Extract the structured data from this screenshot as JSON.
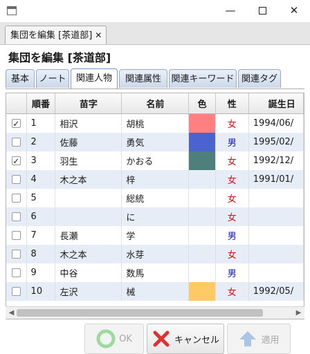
{
  "window": {
    "minimize_glyph": "—",
    "close_glyph": "✕"
  },
  "outer_tab": {
    "label": "集団を編集 [茶道部]",
    "close_glyph": "✕"
  },
  "panel_title": "集団を編集 [茶道部]",
  "inner_tabs": [
    "基本",
    "ノート",
    "関連人物",
    "関連属性",
    "関連キーワード",
    "関連タグ"
  ],
  "active_inner_tab": "関連人物",
  "table": {
    "columns": [
      "",
      "順番",
      "苗字",
      "名前",
      "色",
      "性",
      "誕生日"
    ],
    "rows": [
      {
        "checked": true,
        "order": "1",
        "surname": "相沢",
        "name": "胡桃",
        "color": "#ff8080",
        "sex": "女",
        "birthday": "1994/06/"
      },
      {
        "checked": false,
        "order": "2",
        "surname": "佐藤",
        "name": "勇気",
        "color": "#4b63cf",
        "sex": "男",
        "birthday": "1995/02/"
      },
      {
        "checked": true,
        "order": "3",
        "surname": "羽生",
        "name": "かおる",
        "color": "#4f7f7b",
        "sex": "女",
        "birthday": "1992/12/"
      },
      {
        "checked": false,
        "order": "4",
        "surname": "木之本",
        "name": "梓",
        "color": "",
        "sex": "女",
        "birthday": "1991/01/"
      },
      {
        "checked": false,
        "order": "5",
        "surname": "",
        "name": "総統",
        "color": "",
        "sex": "女",
        "birthday": ""
      },
      {
        "checked": false,
        "order": "6",
        "surname": "",
        "name": "に",
        "color": "",
        "sex": "女",
        "birthday": ""
      },
      {
        "checked": false,
        "order": "7",
        "surname": "長瀬",
        "name": "学",
        "color": "",
        "sex": "男",
        "birthday": ""
      },
      {
        "checked": false,
        "order": "8",
        "surname": "木之本",
        "name": "水芽",
        "color": "",
        "sex": "女",
        "birthday": ""
      },
      {
        "checked": false,
        "order": "9",
        "surname": "中谷",
        "name": "数馬",
        "color": "",
        "sex": "男",
        "birthday": ""
      },
      {
        "checked": false,
        "order": "10",
        "surname": "左沢",
        "name": "械",
        "color": "#ffc966",
        "sex": "女",
        "birthday": "1992/05/"
      }
    ]
  },
  "buttons": {
    "ok": "OK",
    "cancel": "キャンセル",
    "apply": "適用"
  },
  "colors": {
    "female": "#d01010",
    "male": "#1010c0",
    "ok_icon": "#9ed99e",
    "cancel_icon": "#e03030",
    "apply_icon": "#a9c6e6"
  },
  "icons": {
    "app": "window-icon",
    "ok": "ok-circle-icon",
    "cancel": "cross-icon",
    "apply": "up-arrow-icon"
  }
}
